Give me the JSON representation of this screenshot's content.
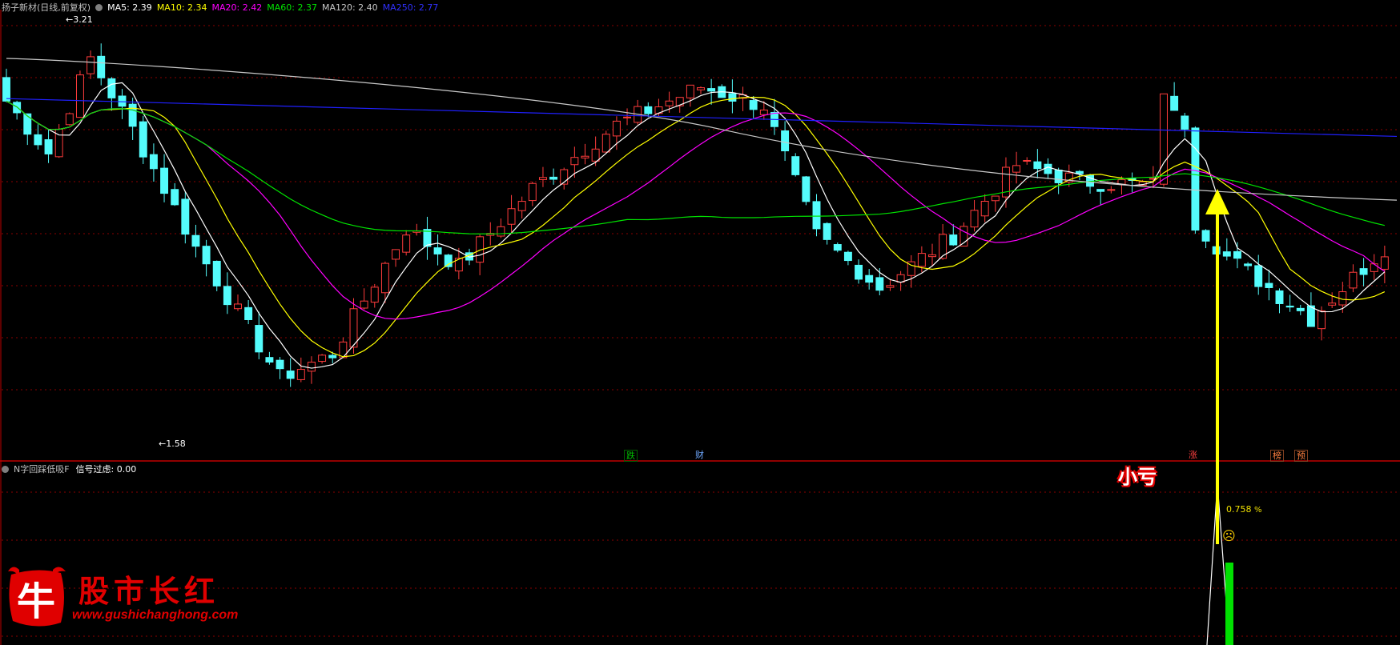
{
  "main_header": {
    "stock": "扬子新材(日线,前复权)",
    "ma5": "MA5: 2.39",
    "ma10": "MA10: 2.34",
    "ma20": "MA20: 2.42",
    "ma60": "MA60: 2.37",
    "ma120": "MA120: 2.40",
    "ma250": "MA250: 2.77"
  },
  "colors": {
    "up": "#ff3c3c",
    "down": "#54fcfc",
    "ma5": "#ffffff",
    "ma10": "#ffff00",
    "ma20": "#ff00ff",
    "ma60": "#00e400",
    "ma120": "#c8c8c8",
    "ma250": "#2020ff",
    "grid": "#8b0000",
    "separator": "#c00000",
    "annotation_arrow": "#ffff00",
    "signal_bar": "#00e000"
  },
  "price_marks": {
    "high": "3.21",
    "low": "1.58"
  },
  "event_tags": [
    {
      "text": "跌",
      "color": "#00c000"
    },
    {
      "text": "财",
      "color": "#6fa8ff"
    },
    {
      "text": "涨",
      "color": "#ff4040"
    },
    {
      "text": "榜",
      "color": "#ff8040"
    },
    {
      "text": "预",
      "color": "#ff8040"
    }
  ],
  "sub_header": {
    "indicator": "N字回踩低吸F",
    "signal": "信号过虑: 0.00"
  },
  "annotation": {
    "label": "小亏",
    "percent": "0.758",
    "percent_unit": "%",
    "face": "☹"
  },
  "watermark": {
    "title": "股市长红",
    "url": "www.gushichanghong.com",
    "logo_char": "牛"
  },
  "chart_data": {
    "type": "candlestick",
    "price_high": 3.21,
    "price_low": 1.58,
    "ma_latest": {
      "MA5": 2.39,
      "MA10": 2.34,
      "MA20": 2.42,
      "MA60": 2.37,
      "MA120": 2.4,
      "MA250": 2.77
    },
    "subchart": {
      "name": "N字回踩低吸F",
      "signal_filter": 0.0,
      "value_percent": 0.758
    }
  }
}
